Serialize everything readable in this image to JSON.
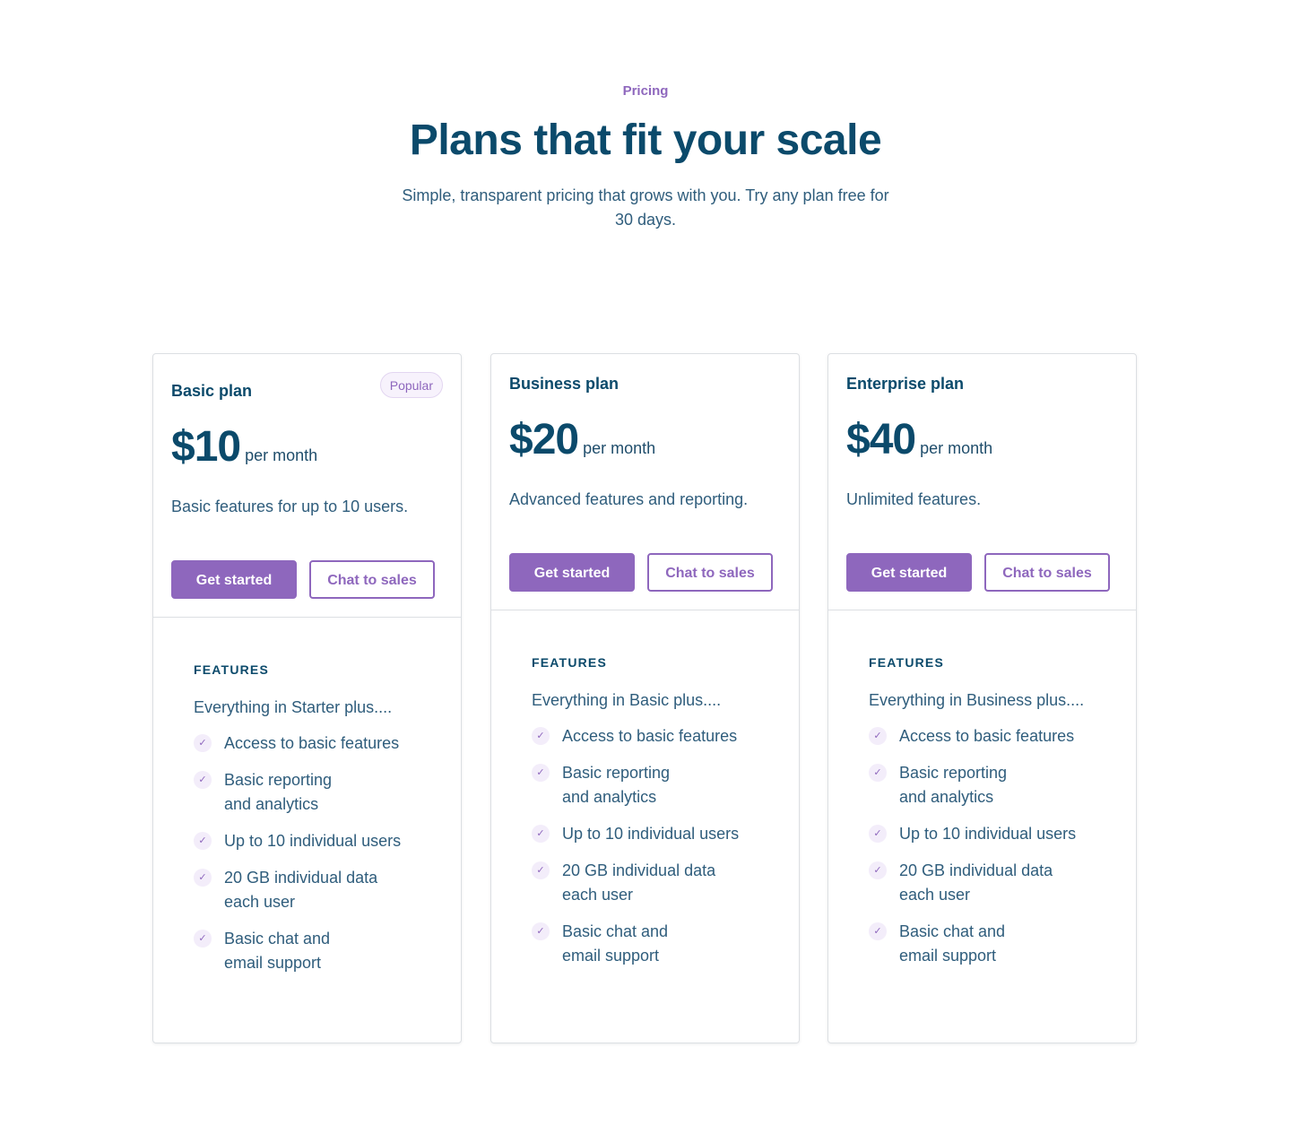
{
  "header": {
    "eyebrow": "Pricing",
    "title": "Plans that fit your scale",
    "subtitle": "Simple, transparent pricing that grows with you. Try any plan free for 30 days."
  },
  "colors": {
    "accent": "#8e67bd",
    "heading": "#0b4a6b",
    "body": "#2f5d7c",
    "border": "#dcdfe3"
  },
  "plans": [
    {
      "name": "Basic plan",
      "badge": "Popular",
      "price": "$10",
      "period": "per month",
      "description": "Basic features for up to 10 users.",
      "primary_cta": "Get started",
      "secondary_cta": "Chat to sales",
      "features_heading": "FEATURES",
      "features_intro": "Everything in Starter plus....",
      "features": [
        {
          "line1": "Access to basic features",
          "line2": ""
        },
        {
          "line1": "Basic reporting",
          "line2": "and analytics"
        },
        {
          "line1": "Up to 10 individual users",
          "line2": ""
        },
        {
          "line1": "20 GB individual data",
          "line2": "each user"
        },
        {
          "line1": "Basic chat and",
          "line2": "email support"
        }
      ]
    },
    {
      "name": "Business plan",
      "badge": "",
      "price": "$20",
      "period": "per month",
      "description": "Advanced features and reporting.",
      "primary_cta": "Get started",
      "secondary_cta": "Chat to sales",
      "features_heading": "FEATURES",
      "features_intro": "Everything in Basic plus....",
      "features": [
        {
          "line1": "Access to basic features",
          "line2": ""
        },
        {
          "line1": "Basic reporting",
          "line2": "and analytics"
        },
        {
          "line1": "Up to 10 individual users",
          "line2": ""
        },
        {
          "line1": "20 GB individual data",
          "line2": "each user"
        },
        {
          "line1": "Basic chat and",
          "line2": "email support"
        }
      ]
    },
    {
      "name": "Enterprise plan",
      "badge": "",
      "price": "$40",
      "period": "per month",
      "description": "Unlimited features.",
      "primary_cta": "Get started",
      "secondary_cta": "Chat to sales",
      "features_heading": "FEATURES",
      "features_intro": "Everything in Business plus....",
      "features": [
        {
          "line1": "Access to basic features",
          "line2": ""
        },
        {
          "line1": "Basic reporting",
          "line2": "and analytics"
        },
        {
          "line1": "Up to 10 individual users",
          "line2": ""
        },
        {
          "line1": "20 GB individual data",
          "line2": "each user"
        },
        {
          "line1": "Basic chat and",
          "line2": "email support"
        }
      ]
    }
  ]
}
